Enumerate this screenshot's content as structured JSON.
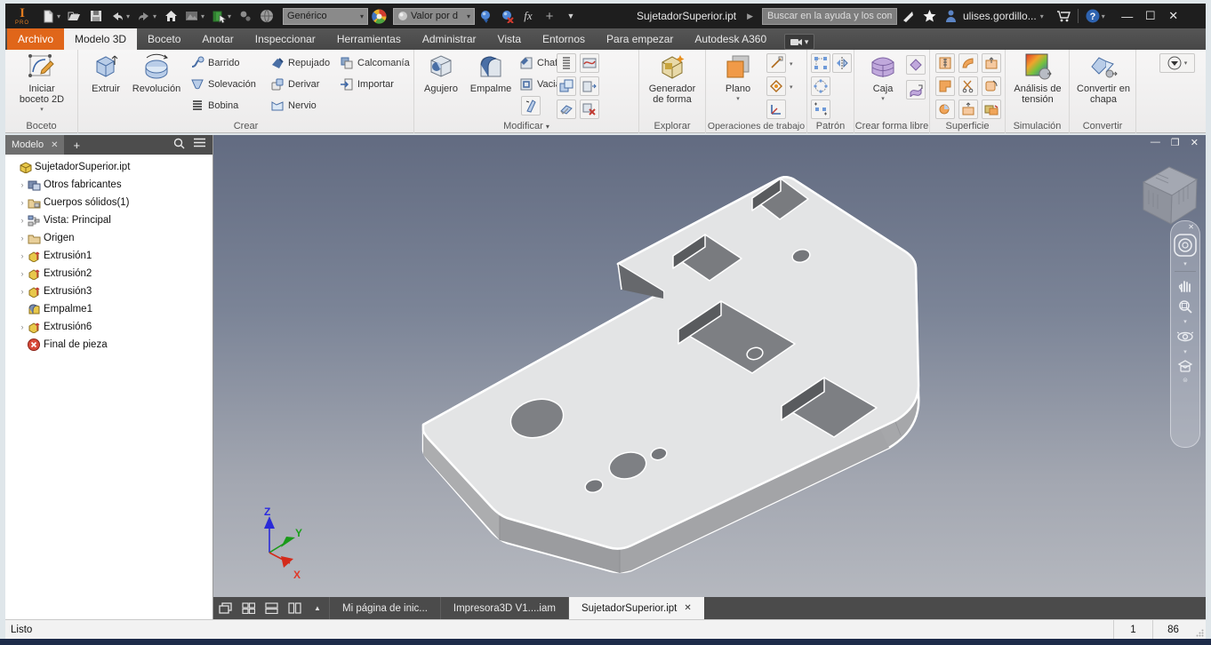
{
  "window": {
    "doc_title": "SujetadorSuperior.ipt",
    "logo_sub": "PRO"
  },
  "qat": {
    "material": "Genérico",
    "appearance": "Valor por d",
    "fx": "fx",
    "search_placeholder": "Buscar en la ayuda y los comanc",
    "user": "ulises.gordillo..."
  },
  "tabs": [
    "Archivo",
    "Modelo 3D",
    "Boceto",
    "Anotar",
    "Inspeccionar",
    "Herramientas",
    "Administrar",
    "Vista",
    "Entornos",
    "Para empezar",
    "Autodesk A360"
  ],
  "ribbon": {
    "boceto": {
      "start_sketch": "Iniciar boceto 2D",
      "panel": "Boceto"
    },
    "crear": {
      "extruir": "Extruir",
      "revolucion": "Revolución",
      "barrido": "Barrido",
      "solevacion": "Solevación",
      "bobina": "Bobina",
      "repujado": "Repujado",
      "derivar": "Derivar",
      "nervio": "Nervio",
      "calcomania": "Calcomanía",
      "importar": "Importar",
      "panel": "Crear"
    },
    "modificar": {
      "agujero": "Agujero",
      "empalme": "Empalme",
      "chaflan": "Chaflán",
      "vaciado": "Vaciado",
      "panel": "Modificar"
    },
    "explorar": {
      "generador": "Generador de forma",
      "panel": "Explorar"
    },
    "operaciones": {
      "plano": "Plano",
      "panel": "Operaciones de trabajo"
    },
    "patron": {
      "panel": "Patrón"
    },
    "forma_libre": {
      "caja": "Caja",
      "panel": "Crear forma libre"
    },
    "superficie": {
      "panel": "Superficie"
    },
    "simulacion": {
      "analisis": "Análisis de tensión",
      "panel": "Simulación"
    },
    "convertir": {
      "chapa": "Convertir en chapa",
      "panel": "Convertir"
    }
  },
  "browser": {
    "tab": "Modelo",
    "tree": [
      "SujetadorSuperior.ipt",
      "Otros fabricantes",
      "Cuerpos sólidos(1)",
      "Vista: Principal",
      "Origen",
      "Extrusión1",
      "Extrusión2",
      "Extrusión3",
      "Empalme1",
      "Extrusión6",
      "Final de pieza"
    ]
  },
  "viewport": {
    "axis_x": "X",
    "axis_y": "Y",
    "axis_z": "Z"
  },
  "doc_tabs": [
    "Mi página de inic...",
    "Impresora3D V1....iam",
    "SujetadorSuperior.ipt"
  ],
  "status": {
    "message": "Listo",
    "counter1": "1",
    "counter2": "86"
  },
  "colors": {
    "accent_orange": "#e0661a",
    "viewport_top": "#626b81",
    "viewport_bottom": "#b5b8bf",
    "part_face": "#e3e4e5"
  }
}
